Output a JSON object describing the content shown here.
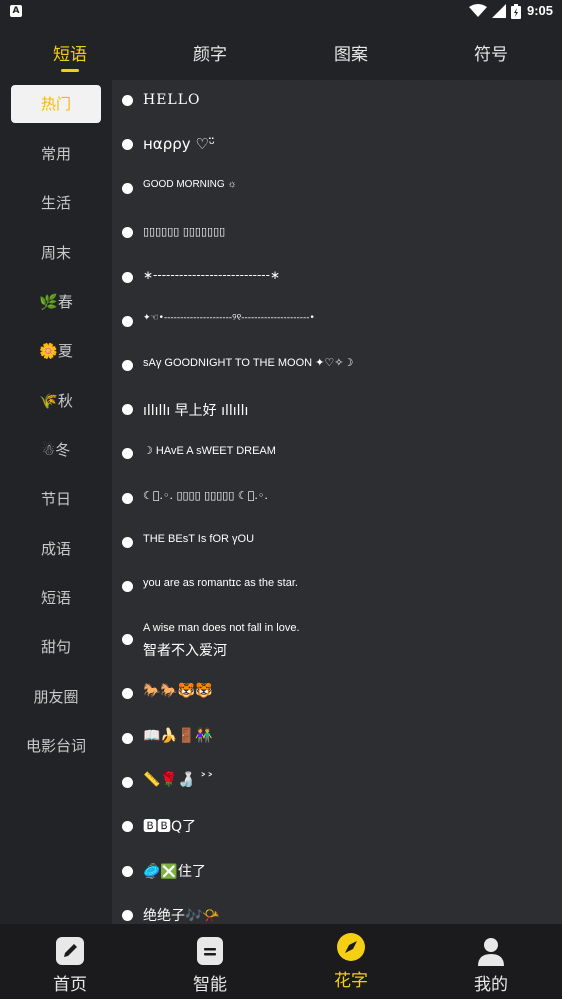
{
  "status_bar": {
    "app_letter": "A",
    "time": "9:05"
  },
  "tabs": [
    {
      "label": "短语",
      "active": true
    },
    {
      "label": "颜字"
    },
    {
      "label": "图案"
    },
    {
      "label": "符号"
    }
  ],
  "sidebar": {
    "items": [
      {
        "label": "热门",
        "active": true
      },
      {
        "label": "常用"
      },
      {
        "label": "生活"
      },
      {
        "label": "周末"
      },
      {
        "label": "🌿春"
      },
      {
        "label": "🌼夏"
      },
      {
        "label": "🌾秋"
      },
      {
        "label": "☃冬"
      },
      {
        "label": "节日"
      },
      {
        "label": "成语"
      },
      {
        "label": "短语"
      },
      {
        "label": "甜句"
      },
      {
        "label": "朋友圈"
      },
      {
        "label": "电影台词"
      }
    ]
  },
  "phrases": [
    {
      "text": "HELLO"
    },
    {
      "text": "нαρρу ♡ᵕ̈"
    },
    {
      "text": "GOOD MORNING ☼"
    },
    {
      "text": "▯▯▯▯▯▯ ▯▯▯▯▯▯▯"
    },
    {
      "text": "∗---------------------------∗"
    },
    {
      "text": "✦☜•---------------------୨୧---------------------•"
    },
    {
      "text": "sAγ GOODNIGHT TO THE MOON ✦♡✧☽"
    },
    {
      "text": "ıllıllı 早上好 ıllıllı"
    },
    {
      "text": "☽ HAvE A sWEET DREAM"
    },
    {
      "text": "☾ﾟ.◦. ▯▯▯▯ ▯▯▯▯▯ ☾ﾟ.◦."
    },
    {
      "text": "THE  BEsT   Is    fOR    γOU"
    },
    {
      "text": "you are as romantɪc as the star."
    },
    {
      "text": "A wise man does not fall in love.",
      "line2": "智者不入爱河"
    },
    {
      "text": "🐎🐎🐯🐯"
    },
    {
      "text": "📖🍌🚪👫"
    },
    {
      "text": "📏🌹🍶 ˃˃"
    },
    {
      "text": "🅱🅱Q了"
    },
    {
      "text": "🥏❎住了"
    },
    {
      "text": "绝绝子🎶📯"
    }
  ],
  "bottom_nav": [
    {
      "label": "首页",
      "icon": "edit-icon"
    },
    {
      "label": "智能",
      "icon": "note-icon"
    },
    {
      "label": "花字",
      "icon": "compass-icon",
      "active": true
    },
    {
      "label": "我的",
      "icon": "person-icon"
    }
  ],
  "colors": {
    "accent": "#f5cf13",
    "background": "#222326",
    "list_bg": "#2d2e31",
    "nav_bg": "#1b1b1d"
  }
}
